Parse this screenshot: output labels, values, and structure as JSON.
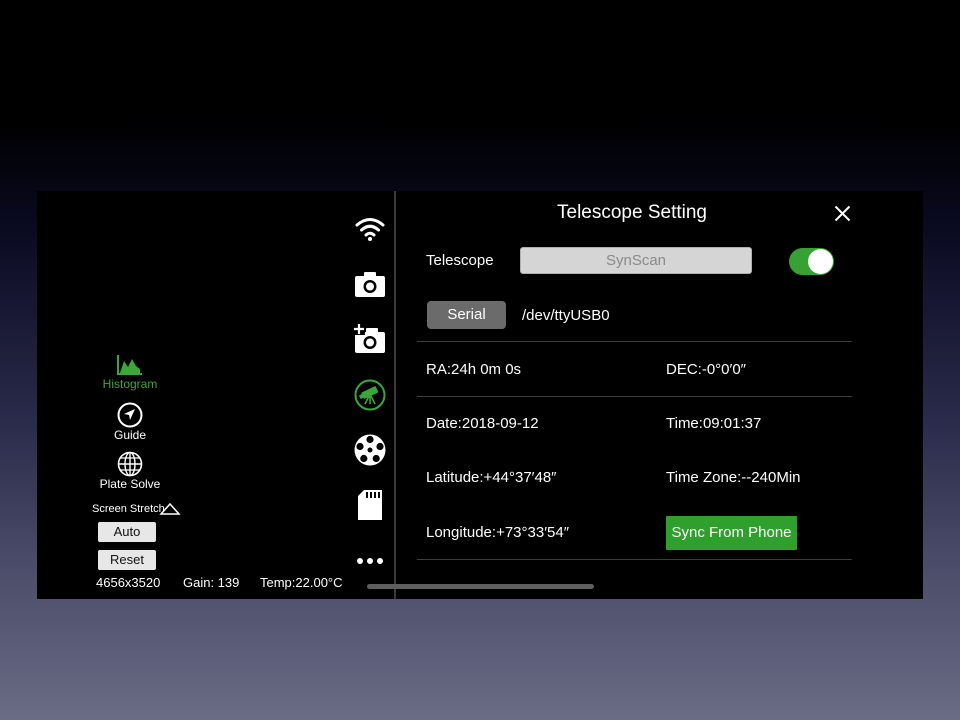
{
  "left_panel": {
    "tools": [
      {
        "label": "Histogram",
        "icon": "histogram-icon",
        "active": true
      },
      {
        "label": "Guide",
        "icon": "guide-arrow-icon",
        "active": false
      },
      {
        "label": "Plate Solve",
        "icon": "globe-icon",
        "active": false
      }
    ],
    "screen_stretch_label": "Screen Stretch",
    "auto_label": "Auto",
    "reset_label": "Reset"
  },
  "status": {
    "resolution": "4656x3520",
    "gain": "Gain: 139",
    "temp": "Temp:22.00°C"
  },
  "sidebar": {
    "icons": [
      "wifi-icon",
      "camera-icon",
      "add-camera-icon",
      "telescope-icon",
      "filter-wheel-icon",
      "sd-card-icon",
      "more-icon"
    ],
    "active": "telescope-icon"
  },
  "dialog": {
    "title": "Telescope Setting",
    "telescope_label": "Telescope",
    "telescope_value": "SynScan",
    "toggle_on": true,
    "serial_label": "Serial",
    "port": "/dev/ttyUSB0",
    "ra": "RA:24h 0m 0s",
    "dec": "DEC:-0°0′0″",
    "date": "Date:2018-09-12",
    "time": "Time:09:01:37",
    "latitude": "Latitude:+44°37′48″",
    "timezone": "Time Zone:--240Min",
    "longitude": "Longitude:+73°33′54″",
    "sync_label": "Sync From Phone"
  },
  "colors": {
    "accent_green": "#3aa838",
    "toggle_green": "#35a233",
    "sync_button": "#2f9f2d",
    "background": "#000000"
  }
}
